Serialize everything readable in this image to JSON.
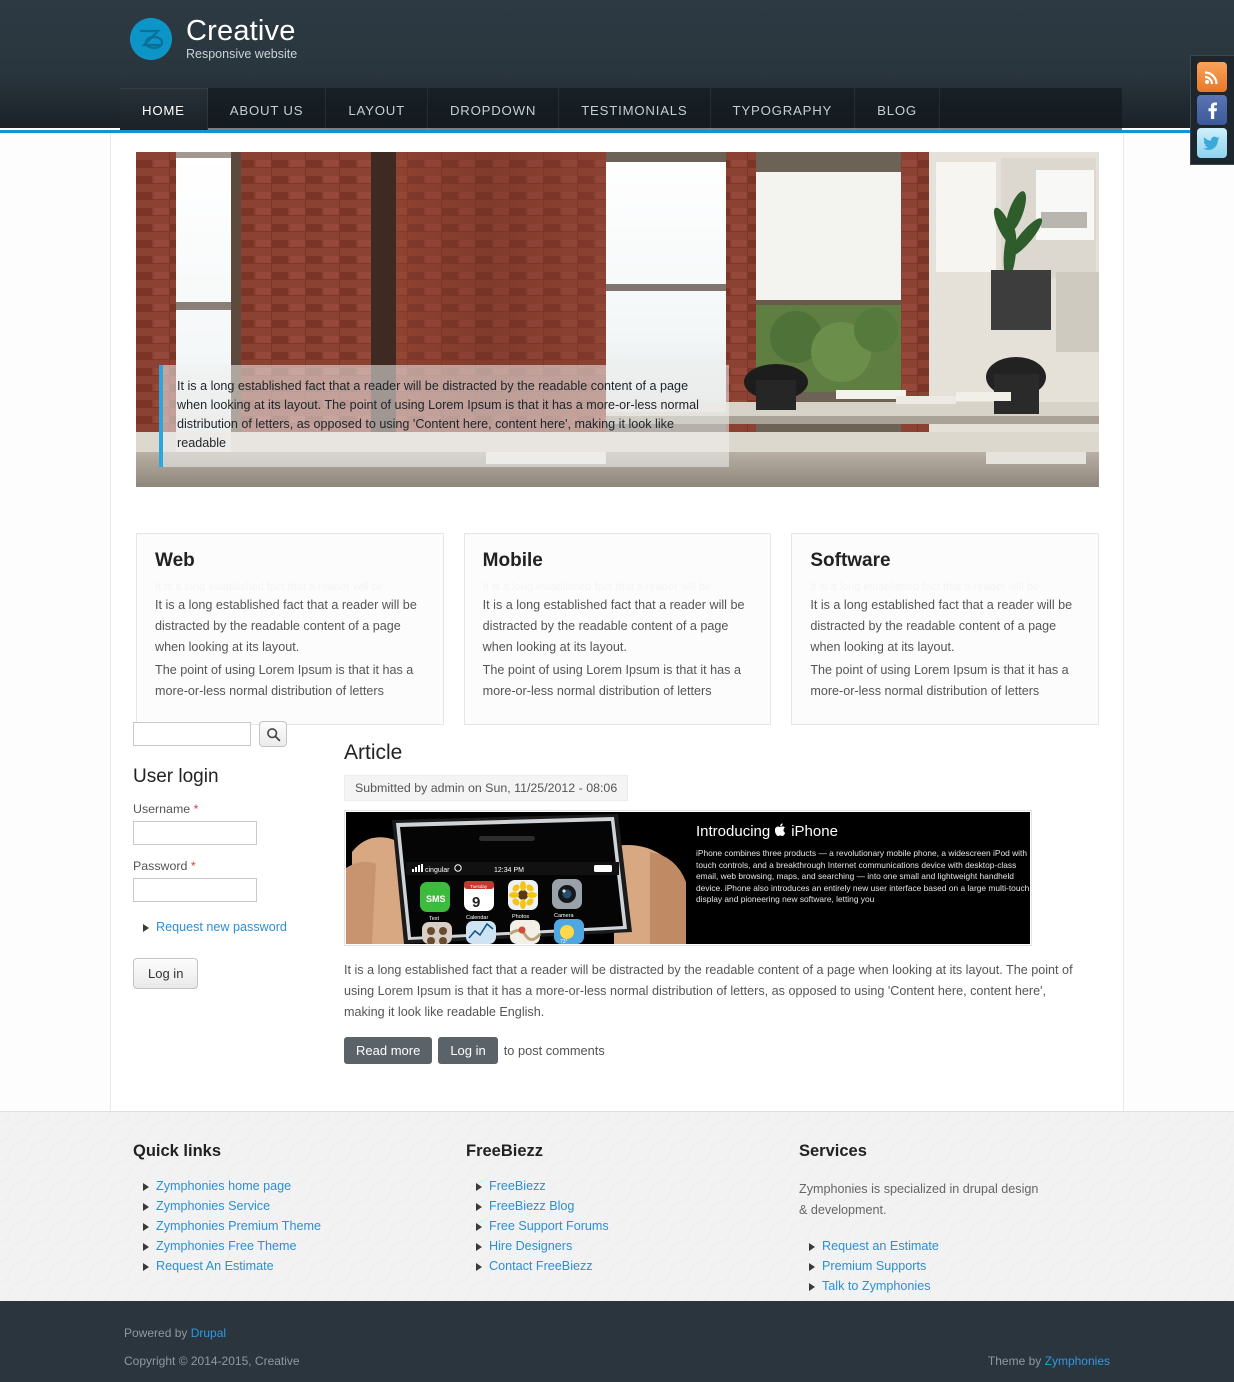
{
  "brand": {
    "title": "Creative",
    "subtitle": "Responsive website",
    "logo_icon": "zymphonies-logo-icon",
    "accent_color": "#0d95c8"
  },
  "nav": {
    "items": [
      {
        "label": "HOME",
        "active": true
      },
      {
        "label": "ABOUT US",
        "active": false
      },
      {
        "label": "LAYOUT",
        "active": false
      },
      {
        "label": "DROPDOWN",
        "active": false
      },
      {
        "label": "TESTIMONIALS",
        "active": false
      },
      {
        "label": "TYPOGRAPHY",
        "active": false
      },
      {
        "label": "BLOG",
        "active": false
      }
    ]
  },
  "social": {
    "items": [
      {
        "name": "rss-icon",
        "label": "RSS"
      },
      {
        "name": "facebook-icon",
        "label": "f"
      },
      {
        "name": "twitter-icon",
        "label": "t"
      }
    ]
  },
  "slider": {
    "caption": "It is a long established fact that a reader will be distracted by the readable content of a page when looking at its layout. The point of using Lorem Ipsum is that it has a more-or-less normal distribution of letters, as opposed to using 'Content here, content here', making it look like readable",
    "accent_color": "#29a8e0"
  },
  "features": [
    {
      "title": "Web",
      "ghost": "It is a long established fact that a reader will be",
      "para1": "It is a long established fact that a reader will be distracted by the readable content of a page when looking at its layout.",
      "para2": "The point of using Lorem Ipsum is that it has a more-or-less normal distribution of letters"
    },
    {
      "title": "Mobile",
      "ghost": "It is a long established fact that a reader will be",
      "para1": "It is a long established fact that a reader will be distracted by the readable content of a page when looking at its layout.",
      "para2": "The point of using Lorem Ipsum is that it has a more-or-less normal distribution of letters"
    },
    {
      "title": "Software",
      "ghost": "It is a long established fact that a reader will be",
      "para1": "It is a long established fact that a reader will be distracted by the readable content of a page when looking at its layout.",
      "para2": "The point of using Lorem Ipsum is that it has a more-or-less normal distribution of letters"
    }
  ],
  "sidebar": {
    "search": {
      "value": "",
      "placeholder": "",
      "icon": "search-icon"
    },
    "login": {
      "title": "User login",
      "username_label": "Username",
      "username_value": "",
      "password_label": "Password",
      "password_value": "",
      "required_marker": "*",
      "request_password_link": "Request new password",
      "submit_label": "Log in"
    }
  },
  "article": {
    "title": "Article",
    "submitted": "Submitted by admin on Sun, 11/25/2012 - 08:06",
    "ad": {
      "headline_pre": "Introducing",
      "apple_glyph": "",
      "headline_post": "iPhone",
      "body": "iPhone combines three products — a revolutionary mobile phone, a widescreen iPod with touch controls, and a breakthrough Internet communications device with desktop-class email, web browsing, maps, and searching — into one small and lightweight handheld device. iPhone also introduces an entirely new user interface based on a large multi-touch display and pioneering new software, letting you",
      "status_carrier": "cingular",
      "status_time": "12:34 PM",
      "app_labels": [
        "Text",
        "Calendar",
        "Photos",
        "Camera"
      ],
      "calendar_day": "9",
      "calendar_weekday": "Tuesday",
      "sms_badge": "SMS"
    },
    "body": "It is a long established fact that a reader will be distracted by the readable content of a page when looking at its layout. The point of using Lorem Ipsum is that it has a more-or-less normal distribution of letters, as opposed to using 'Content here, content here', making it look like readable English.",
    "read_more_label": "Read more",
    "login_label": "Log in",
    "post_comments_note": "to post comments"
  },
  "footer": {
    "columns": [
      {
        "title": "Quick links",
        "description": "",
        "links": [
          "Zymphonies home page",
          "Zymphonies Service",
          "Zymphonies Premium Theme",
          "Zymphonies Free Theme",
          "Request An Estimate"
        ]
      },
      {
        "title": "FreeBiezz",
        "description": "",
        "links": [
          "FreeBiezz",
          "FreeBiezz Blog",
          "Free Support Forums",
          "Hire Designers",
          "Contact FreeBiezz"
        ]
      },
      {
        "title": "Services",
        "description": "Zymphonies is specialized in drupal design & development.",
        "links": [
          "Request an Estimate",
          "Premium Supports",
          "Talk to Zymphonies"
        ]
      }
    ]
  },
  "bottom": {
    "powered_prefix": "Powered by ",
    "powered_link": "Drupal",
    "copyright": "Copyright © 2014-2015, Creative",
    "theme_prefix": "Theme by ",
    "theme_link": "Zymphonies"
  }
}
